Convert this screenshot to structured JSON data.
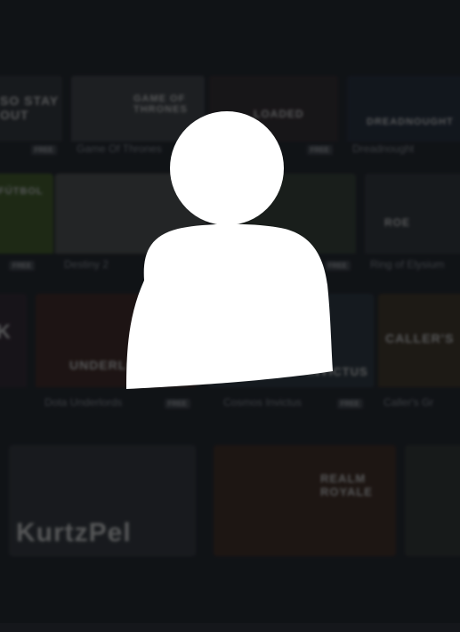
{
  "library": {
    "tiles": [
      {
        "title": "",
        "badge": "FREE",
        "logo": "SO STAY OUT"
      },
      {
        "title": "Game Of Thrones",
        "badge": "",
        "logo": "GAME OF THRONES"
      },
      {
        "title": "",
        "badge": "FREE",
        "logo": "LOADED"
      },
      {
        "title": "Dreadnought",
        "badge": "",
        "logo": "DREADNOUGHT"
      },
      {
        "title": "",
        "badge": "FREE",
        "logo": "FÚTBOL"
      },
      {
        "title": "Destiny 2",
        "badge": "",
        "logo": "DESTINY 2"
      },
      {
        "title": "",
        "badge": "FREE",
        "logo": ""
      },
      {
        "title": "Ring of Elysium",
        "badge": "",
        "logo": "ROE"
      },
      {
        "title": "",
        "badge": "",
        "logo": "K"
      },
      {
        "title": "Dota Underlords",
        "badge": "FREE",
        "logo": "UNDERLORDS"
      },
      {
        "title": "Cosmos Invictus",
        "badge": "FREE",
        "logo": "INVICTUS"
      },
      {
        "title": "Caller's Gr",
        "badge": "",
        "logo": "CALLER'S"
      },
      {
        "title": "",
        "badge": "",
        "logo": "KurtzPel"
      },
      {
        "title": "",
        "badge": "",
        "logo": "REALM ROYALE"
      }
    ]
  },
  "profile": {
    "avatar_icon": "user-silhouette-icon",
    "color": "#ffffff"
  }
}
